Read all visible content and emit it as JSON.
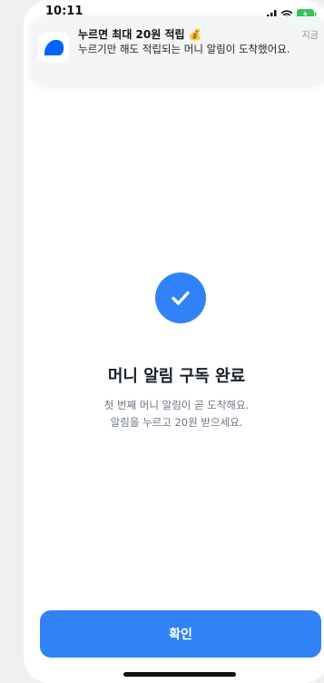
{
  "status_bar": {
    "time": "10:11"
  },
  "notification": {
    "title": "누르면 최대 20원 적립 💰",
    "time": "지금",
    "body": "누르기만 해도 적립되는 머니 알림이 도착했어요.",
    "app_icon": "toss-icon"
  },
  "main": {
    "title": "머니 알림 구독 완료",
    "desc_line1": "첫 번째 머니 알림이 곧 도착해요.",
    "desc_line2": "알림을 누르고 20원 받으세요.",
    "check_icon": "check-icon"
  },
  "footer": {
    "confirm_label": "확인"
  },
  "colors": {
    "accent": "#3182f6",
    "battery": "#34c759"
  }
}
